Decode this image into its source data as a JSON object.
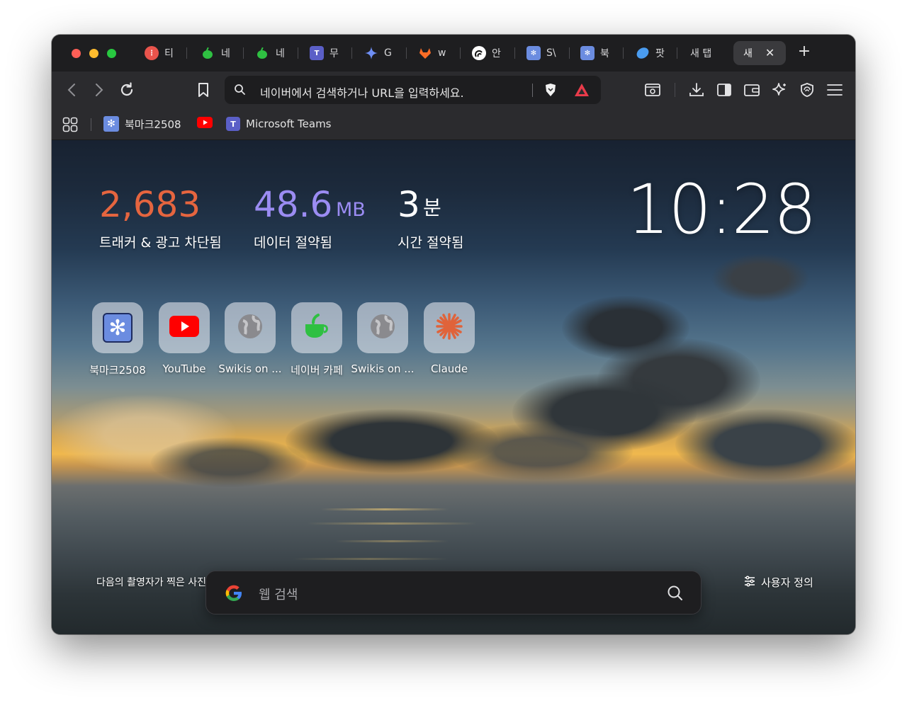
{
  "tabs": [
    {
      "label": "티",
      "icon": "red-vertical-dots-icon"
    },
    {
      "label": "네",
      "icon": "green-cup-icon"
    },
    {
      "label": "네",
      "icon": "green-cup-icon"
    },
    {
      "label": "무",
      "icon": "teams-icon"
    },
    {
      "label": "G",
      "icon": "gemini-star-icon"
    },
    {
      "label": "w",
      "icon": "gitlab-fox-icon"
    },
    {
      "label": "안",
      "icon": "circle-logo-icon"
    },
    {
      "label": "S\\",
      "icon": "puzzle-icon"
    },
    {
      "label": "북",
      "icon": "puzzle-icon"
    },
    {
      "label": "팟",
      "icon": "blue-drop-icon"
    },
    {
      "label": "새 탭",
      "icon": ""
    }
  ],
  "active_tab": {
    "label": "새"
  },
  "toolbar": {
    "url_placeholder": "네이버에서 검색하거나 URL을 입력하세요."
  },
  "bookmarks": [
    {
      "label": "북마크2508",
      "icon": "puzzle-icon"
    },
    {
      "label": "",
      "icon": "youtube-icon"
    },
    {
      "label": "Microsoft Teams",
      "icon": "teams-icon"
    }
  ],
  "stats": {
    "trackers": {
      "value": "2,683",
      "label": "트래커 & 광고 차단됨"
    },
    "data": {
      "value": "48.6",
      "unit": "MB",
      "label": "데이터 절약됨"
    },
    "time": {
      "value": "3",
      "unit": "분",
      "label": "시간 절약됨"
    }
  },
  "clock": "10:28",
  "shortcuts": [
    {
      "label": "북마크2508",
      "icon": "puzzle-icon"
    },
    {
      "label": "YouTube",
      "icon": "youtube-icon"
    },
    {
      "label": "Swikis on ...",
      "icon": "globe-icon"
    },
    {
      "label": "네이버 카페",
      "icon": "green-cup-icon"
    },
    {
      "label": "Swikis on ...",
      "icon": "globe-icon"
    },
    {
      "label": "Claude",
      "icon": "claude-sunburst-icon"
    }
  ],
  "footer": {
    "credit": "다음의 촬영자가 찍은 사진",
    "search_placeholder": "웹 검색",
    "customize": "사용자 정의"
  },
  "colors": {
    "trackers": "#e5653f",
    "data": "#9b8cf2",
    "time": "#ffffff"
  }
}
